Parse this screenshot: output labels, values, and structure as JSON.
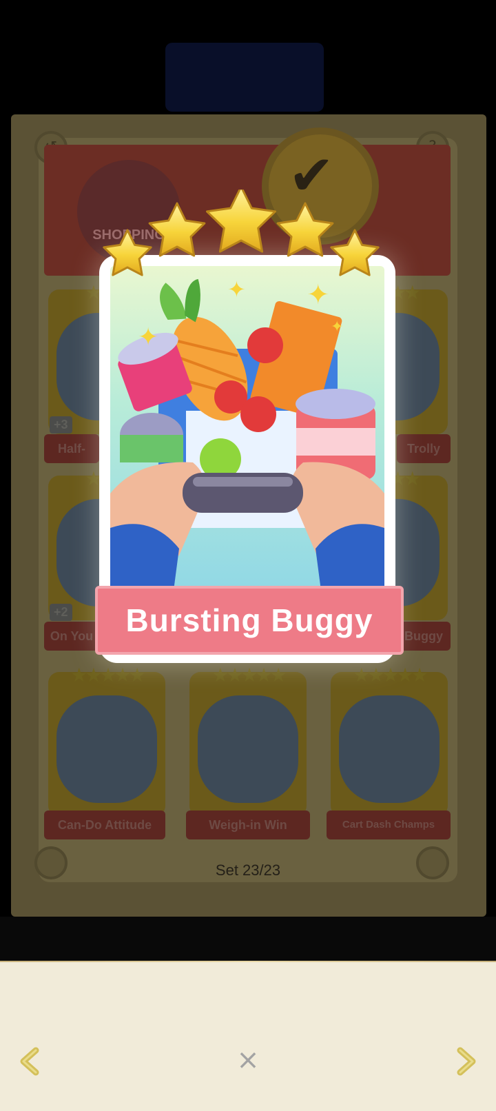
{
  "album": {
    "banner_logo_text": "SHOPPING",
    "set_label": "Set 23/23",
    "background_cards": [
      {
        "label": "Half-",
        "count": "+3"
      },
      {
        "label": "Trolly",
        "count": ""
      },
      {
        "label": "On You",
        "count": "+2"
      },
      {
        "label": "Buggy",
        "count": ""
      },
      {
        "label": "Can-Do Attitude",
        "count": ""
      },
      {
        "label": "Weigh-in Win",
        "count": ""
      },
      {
        "label": "Cart Dash Champs",
        "count": ""
      }
    ]
  },
  "card": {
    "title": "Bursting Buggy",
    "stars": 5,
    "colors": {
      "ribbon": "#ee7b87",
      "star": "#f7d43a",
      "frame": "#ffffff"
    }
  },
  "bottom_bar": {
    "prev_icon": "chevron-left-icon",
    "close_label": "×",
    "next_icon": "chevron-right-icon",
    "accent_color": "#d4c05a"
  }
}
